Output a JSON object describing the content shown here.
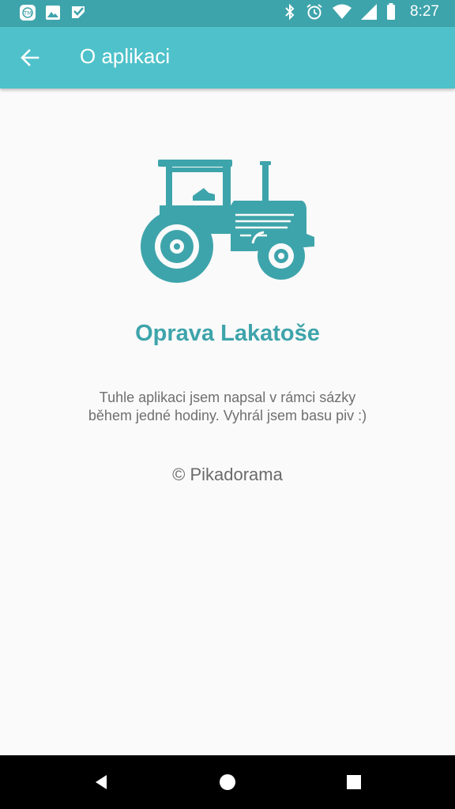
{
  "status_bar": {
    "time": "8:27",
    "left_icons": [
      "app-notification-icon",
      "image-icon",
      "check-icon"
    ],
    "right_icons": [
      "bluetooth-icon",
      "alarm-icon",
      "wifi-icon",
      "signal-icon",
      "battery-icon"
    ]
  },
  "app_bar": {
    "title": "O aplikaci",
    "back_icon": "arrow-back-icon"
  },
  "main": {
    "logo_icon": "tractor-icon",
    "app_name": "Oprava Lakatoše",
    "description_line1": "Tuhle aplikaci jsem napsal v rámci sázky",
    "description_line2": "během jedné hodiny. Vyhrál jsem basu piv :)",
    "copyright": "© Pikadorama"
  },
  "nav_bar": {
    "buttons": [
      "back-triangle-icon",
      "home-circle-icon",
      "recents-square-icon"
    ]
  },
  "colors": {
    "status_bar": "#3ea4ab",
    "app_bar": "#4fc1ca",
    "accent": "#3ea4ab",
    "background": "#fafafa",
    "text_secondary": "#6f6f6f"
  }
}
